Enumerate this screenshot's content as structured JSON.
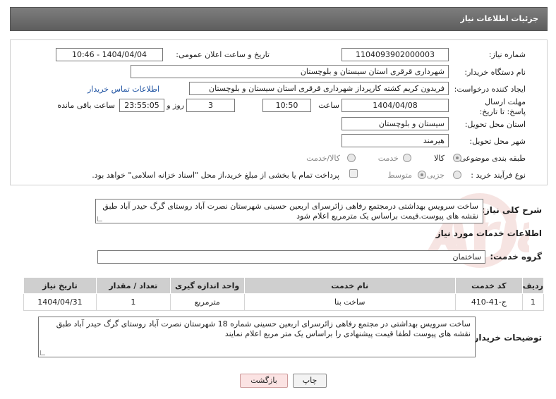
{
  "header": {
    "title": "جزئیات اطلاعات نیاز"
  },
  "fields": {
    "need_number_label": "شماره نیاز:",
    "need_number": "1104093902000003",
    "announce_label": "تاریخ و ساعت اعلان عمومی:",
    "announce_value": "1404/04/04 - 10:46",
    "buyer_label": "نام دستگاه خریدار:",
    "buyer": "شهرداری قرقری استان سیستان و بلوچستان",
    "creator_label": "ایجاد کننده درخواست:",
    "creator": "فریدون کریم کشته کارپرداز شهرداری قرقری استان سیستان و بلوچستان",
    "contact_link": "اطلاعات تماس خریدار",
    "deadline_label": "مهلت ارسال پاسخ: تا تاریخ:",
    "deadline_date": "1404/04/08",
    "time_label": "ساعت",
    "deadline_time": "10:50",
    "days_value": "3",
    "days_label": "روز و",
    "remaining_time": "23:55:05",
    "remaining_label": "ساعت باقی مانده",
    "province_label": "استان محل تحویل:",
    "province": "سیستان و بلوچستان",
    "city_label": "شهر محل تحویل:",
    "city": "هیرمند",
    "category_label": "طبقه بندی موضوعی:",
    "category_options": [
      "کالا",
      "خدمت",
      "کالا/خدمت"
    ],
    "process_label": "نوع فرآیند خرید :",
    "process_options": [
      "جزیی",
      "متوسط"
    ],
    "payment_note": "پرداخت تمام یا بخشی از مبلغ خرید،از محل \"اسناد خزانه اسلامی\" خواهد بود."
  },
  "summary": {
    "label": "شرح کلی نیاز:",
    "text": "ساخت سرویس بهداشتی درمجتمع رفاهی زائرسرای اربعین حسینی شهرستان نصرت آباد روستای گرگ حیدر آباد طبق نقشه های پیوست.قیمت براساس یک مترمربع اعلام شود"
  },
  "services": {
    "title": "اطلاعات خدمات مورد نیاز",
    "group_label": "گروه خدمت:",
    "group_value": "ساختمان",
    "columns": [
      "ردیف",
      "کد خدمت",
      "نام خدمت",
      "واحد اندازه گیری",
      "تعداد / مقدار",
      "تاریخ نیاز"
    ],
    "rows": [
      [
        "1",
        "ج-41-410",
        "ساخت بنا",
        "مترمربع",
        "1",
        "1404/04/31"
      ]
    ]
  },
  "buyer_notes": {
    "label": "توضیحات خریدار:",
    "text": "ساخت سرویس بهداشتی در مجتمع رفاهی زائرسرای اربعین حسینی شماره 18 شهرستان نصرت آباد روستای گرگ حیدر آباد طبق نقشه های پیوست لطفا قیمت پیشنهادی را براساس یک متر مربع اعلام نمایند"
  },
  "buttons": {
    "print": "چاپ",
    "back": "بازگشت"
  },
  "watermark": {
    "text": "AriaTender.neT"
  }
}
